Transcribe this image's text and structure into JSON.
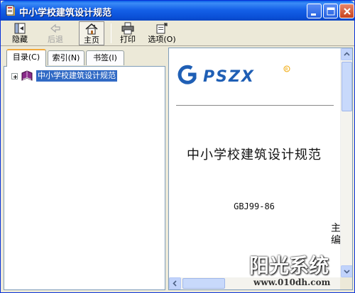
{
  "window": {
    "title": "中小学校建筑设计规范"
  },
  "toolbar": {
    "hide_label": "隐藏",
    "back_label": "后退",
    "home_label": "主页",
    "print_label": "打印",
    "options_label": "选项(O)"
  },
  "tabs": [
    {
      "label": "目录(C)"
    },
    {
      "label": "索引(N)"
    },
    {
      "label": "书签(I)"
    }
  ],
  "tree": {
    "items": [
      {
        "label": "中小学校建筑设计规范"
      }
    ]
  },
  "document": {
    "logo_text": "GPSZX",
    "title": "中小学校建筑设计规范",
    "code": "GBJ99-86",
    "editor_chars": "主编"
  },
  "watermark": {
    "text": "阳光系统",
    "url": "www.010dh.com"
  },
  "colors": {
    "titlebar": "#0a4fd6",
    "selection": "#316ac5",
    "logo_blue": "#1f5fb5",
    "logo_accent": "#f0a500"
  }
}
